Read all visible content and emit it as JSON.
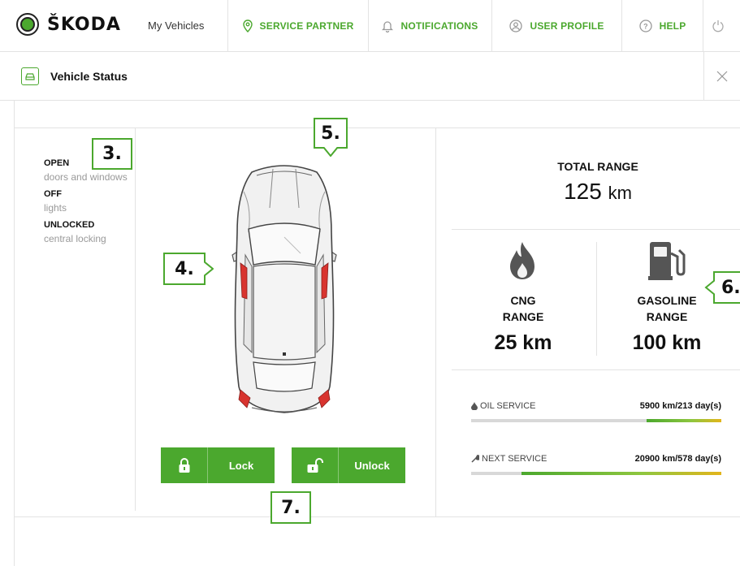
{
  "brand": "ŠKODA",
  "nav": {
    "my_vehicles": "My Vehicles",
    "service_partner": "SERVICE PARTNER",
    "notifications": "NOTIFICATIONS",
    "user_profile": "USER PROFILE",
    "help": "HELP"
  },
  "page": {
    "title": "Vehicle Status"
  },
  "status": [
    {
      "value": "OPEN",
      "label": "doors and windows"
    },
    {
      "value": "OFF",
      "label": "lights"
    },
    {
      "value": "UNLOCKED",
      "label": "central locking"
    }
  ],
  "buttons": {
    "lock": "Lock",
    "unlock": "Unlock"
  },
  "range": {
    "total_label": "TOTAL RANGE",
    "total_value": "125",
    "total_unit": "km",
    "cng_name_1": "CNG",
    "cng_name_2": "RANGE",
    "cng_value": "25 km",
    "gas_name_1": "GASOLINE",
    "gas_name_2": "RANGE",
    "gas_value": "100 km"
  },
  "service": {
    "oil": {
      "name": "OIL SERVICE",
      "value": "5900 km/213 day(s)",
      "remaining_fraction": 0.3
    },
    "next": {
      "name": "NEXT SERVICE",
      "value": "20900 km/578 day(s)",
      "remaining_fraction": 0.8
    }
  },
  "callouts": {
    "c3": "3.",
    "c4": "4.",
    "c5": "5.",
    "c6": "6.",
    "c7": "7."
  },
  "colors": {
    "accent": "#4ba82e",
    "warning": "#e3b51b",
    "tail_light": "#d8342f"
  },
  "icons": [
    "pin-icon",
    "bell-icon",
    "user-icon",
    "help-icon",
    "power-icon",
    "car-icon",
    "close-icon",
    "lock-icon",
    "unlock-icon",
    "flame-icon",
    "fuel-pump-icon",
    "drop-icon",
    "wrench-icon"
  ]
}
